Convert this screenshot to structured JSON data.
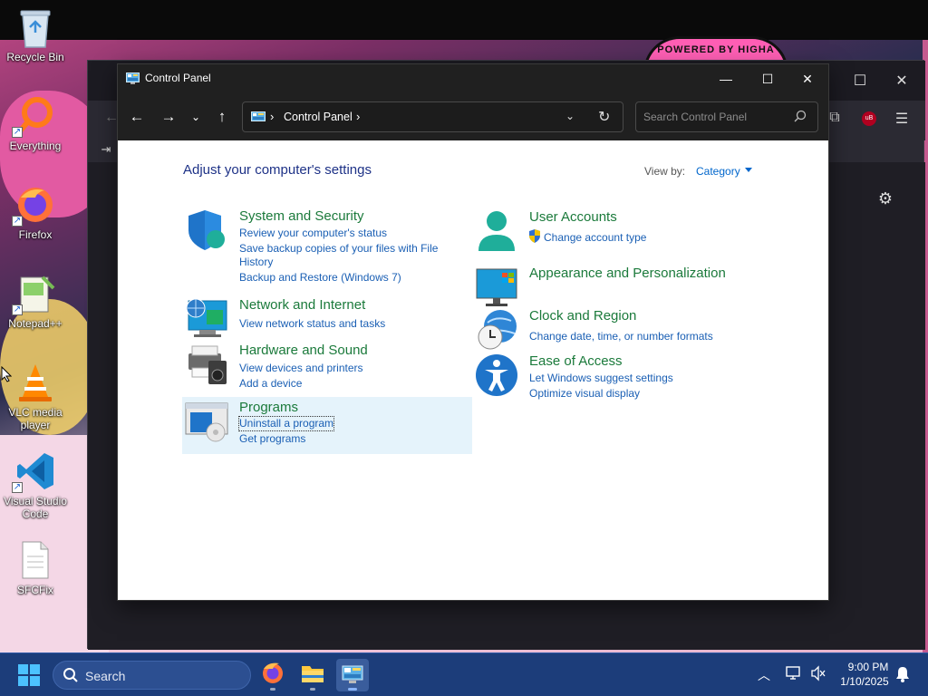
{
  "desktop": {
    "wallpaper_badge": "POWERED BY HIGHA",
    "icons": [
      {
        "label": "Recycle Bin",
        "icon": "recycle-bin-icon"
      },
      {
        "label": "Everything",
        "icon": "everything-search-icon"
      },
      {
        "label": "Firefox",
        "icon": "firefox-icon"
      },
      {
        "label": "Notepad++",
        "icon": "notepad-plus-plus-icon"
      },
      {
        "label": "VLC media player",
        "icon": "vlc-icon"
      },
      {
        "label": "Visual Studio Code",
        "icon": "vscode-icon"
      },
      {
        "label": "SFCFix",
        "icon": "document-icon"
      }
    ]
  },
  "window": {
    "title": "Control Panel",
    "controls": {
      "minimize": "—",
      "maximize": "☐",
      "close": "✕"
    }
  },
  "nav": {
    "address": "Control Panel",
    "search_placeholder": "Search Control Panel"
  },
  "content": {
    "heading": "Adjust your computer's settings",
    "view_by_label": "View by:",
    "view_by_value": "Category",
    "categories": [
      {
        "title": "System and Security",
        "icon": "shield-icon",
        "links": [
          "Review your computer's status",
          "Save backup copies of your files with File History",
          "Backup and Restore (Windows 7)"
        ]
      },
      {
        "title": "Network and Internet",
        "icon": "network-globe-icon",
        "links": [
          "View network status and tasks"
        ]
      },
      {
        "title": "Hardware and Sound",
        "icon": "printer-speaker-icon",
        "links": [
          "View devices and printers",
          "Add a device"
        ]
      },
      {
        "title": "Programs",
        "icon": "programs-icon",
        "links": [
          "Uninstall a program",
          "Get programs"
        ]
      },
      {
        "title": "User Accounts",
        "icon": "user-icon",
        "links": [
          "Change account type"
        ]
      },
      {
        "title": "Appearance and Personalization",
        "icon": "monitor-icon",
        "links": []
      },
      {
        "title": "Clock and Region",
        "icon": "clock-globe-icon",
        "links": [
          "Change date, time, or number formats"
        ]
      },
      {
        "title": "Ease of Access",
        "icon": "accessibility-icon",
        "links": [
          "Let Windows suggest settings",
          "Optimize visual display"
        ]
      }
    ]
  },
  "taskbar": {
    "search_label": "Search",
    "apps": [
      "firefox-icon",
      "file-explorer-icon",
      "control-panel-icon"
    ],
    "time": "9:00 PM",
    "date": "1/10/2025"
  },
  "colors": {
    "category_title": "#1b7a3b",
    "link": "#1a5fb4",
    "heading": "#1e3287",
    "taskbar": "#1c3d7a"
  }
}
